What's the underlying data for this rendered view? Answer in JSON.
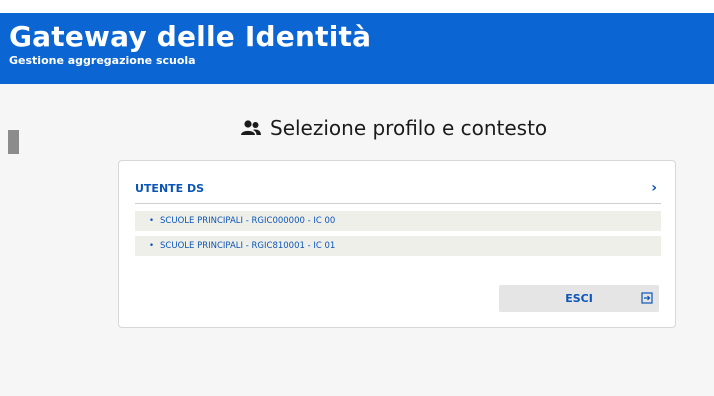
{
  "header": {
    "title": "Gateway delle Identità",
    "subtitle": "Gestione aggregazione scuola"
  },
  "page": {
    "title": "Selezione profilo e contesto",
    "title_icon": "users-icon"
  },
  "card": {
    "profile_label": "UTENTE DS",
    "profile_chevron": "›",
    "contexts": [
      {
        "bullet": "•",
        "label": "SCUOLE PRINCIPALI - RGIC000000 - IC 00"
      },
      {
        "bullet": "•",
        "label": "SCUOLE PRINCIPALI - RGIC810001 - IC 01"
      }
    ],
    "exit_label": "ESCI",
    "exit_icon": "logout-icon"
  },
  "colors": {
    "brand_blue": "#0b66d4",
    "link_blue": "#0b55b8",
    "page_bg": "#f6f6f6"
  }
}
